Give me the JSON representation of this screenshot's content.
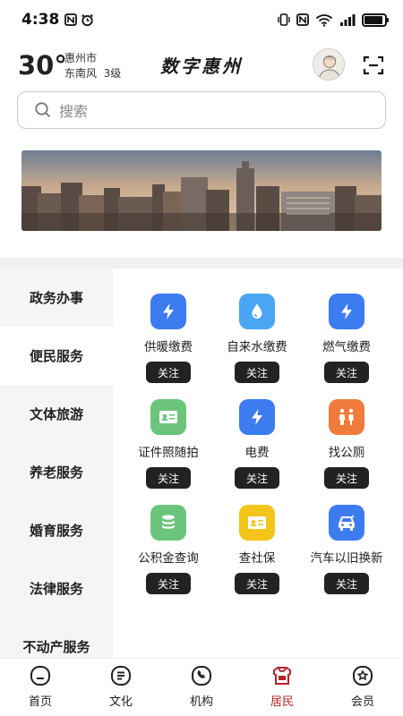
{
  "status_bar": {
    "time": "4:38",
    "left_icons": [
      "nfc-icon",
      "alarm-icon"
    ],
    "right_icons": [
      "vibrate-icon",
      "nfc-icon",
      "wifi-icon",
      "signal-icon",
      "battery-icon"
    ],
    "battery_level": 0.9
  },
  "header": {
    "temperature": "30°",
    "city": "惠州市",
    "wind": "东南风  3级",
    "title": "数字惠州"
  },
  "search": {
    "placeholder": "搜索"
  },
  "categories": [
    {
      "label": "政务办事"
    },
    {
      "label": "便民服务"
    },
    {
      "label": "文体旅游"
    },
    {
      "label": "养老服务"
    },
    {
      "label": "婚育服务"
    },
    {
      "label": "法律服务"
    },
    {
      "label": "不动产服务"
    }
  ],
  "active_category": "便民服务",
  "follow_label": "关注",
  "services": [
    {
      "label": "供暖缴费",
      "icon": "lightning-icon",
      "color": "#3d7bf1"
    },
    {
      "label": "自来水缴费",
      "icon": "water-drop-icon",
      "color": "#4aa6f3"
    },
    {
      "label": "燃气缴费",
      "icon": "lightning-icon",
      "color": "#3d7bf1"
    },
    {
      "label": "证件照随拍",
      "icon": "id-card-icon",
      "color": "#6cc47c"
    },
    {
      "label": "电费",
      "icon": "lightning-icon",
      "color": "#3d7bf1"
    },
    {
      "label": "找公厕",
      "icon": "restroom-icon",
      "color": "#f07b3c"
    },
    {
      "label": "公积金查询",
      "icon": "coin-stack-icon",
      "color": "#6cc47c"
    },
    {
      "label": "查社保",
      "icon": "id-card-icon",
      "color": "#f5c41b"
    },
    {
      "label": "汽车以旧换新",
      "icon": "car-icon",
      "color": "#3d7bf1"
    }
  ],
  "tabs": [
    {
      "label": "首页",
      "icon": "home-icon"
    },
    {
      "label": "文化",
      "icon": "culture-icon"
    },
    {
      "label": "机构",
      "icon": "institution-icon"
    },
    {
      "label": "居民",
      "icon": "resident-icon"
    },
    {
      "label": "会员",
      "icon": "member-icon"
    }
  ],
  "active_tab": "居民",
  "colors": {
    "accent": "#b3232b",
    "follow_bg": "#222222"
  }
}
